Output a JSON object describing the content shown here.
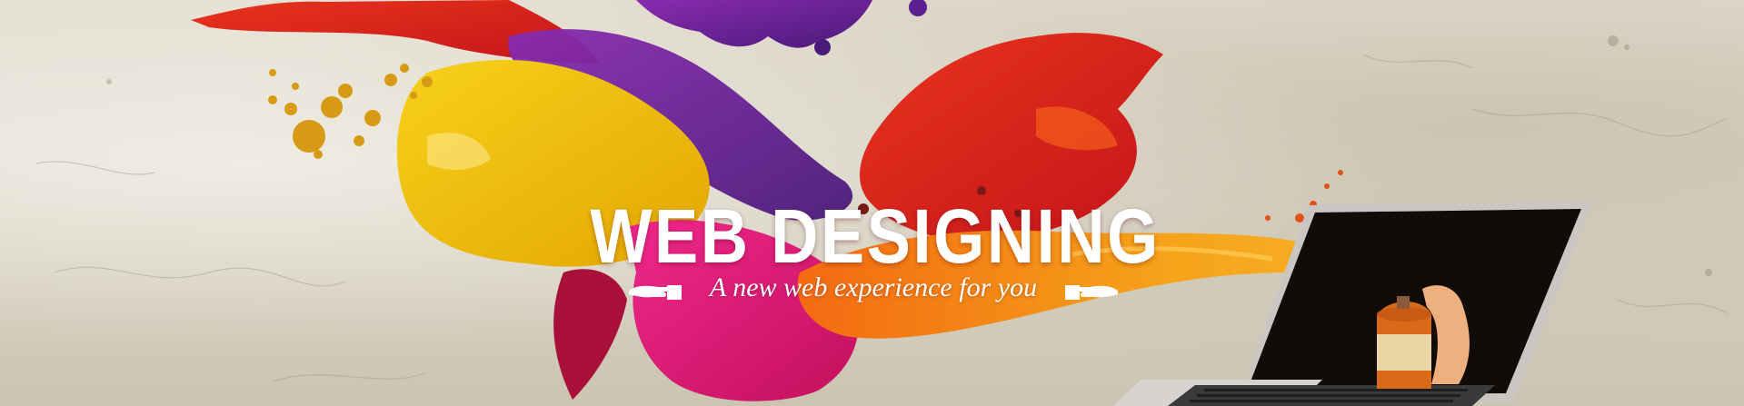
{
  "banner": {
    "headline": "WEB DESIGNING",
    "tagline": "A new web experience for you"
  },
  "icons": {
    "left_hand": "pointing-hand-right-icon",
    "right_hand": "pointing-hand-left-icon"
  },
  "colors": {
    "wall": "#d9d4c6",
    "paint_yellow": "#f2c200",
    "paint_orange": "#f07a10",
    "paint_red": "#d8261e",
    "paint_magenta": "#e0157a",
    "paint_purple": "#6a1f8a",
    "text": "#ffffff"
  }
}
